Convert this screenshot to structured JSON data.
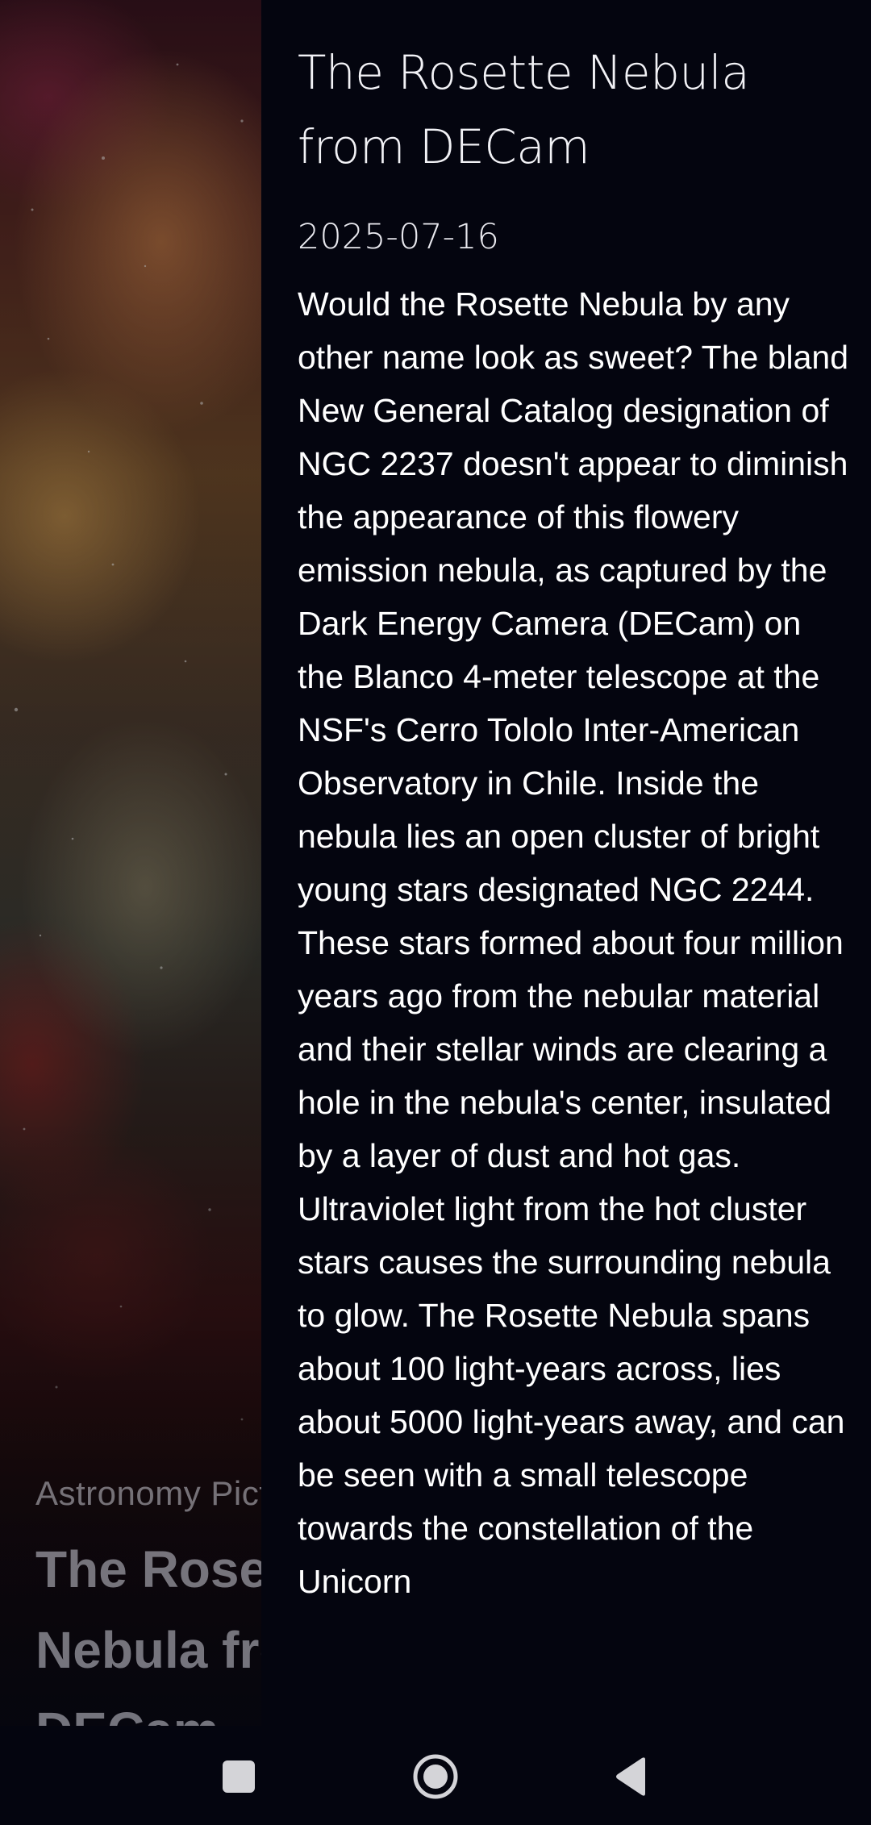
{
  "background_card": {
    "subtitle": "Astronomy Picture of the Day",
    "title": "The Rosette Nebula from DECam"
  },
  "detail": {
    "title": "The Rosette Nebula from DECam",
    "date": "2025-07-16",
    "explanation": "Would the Rosette Nebula by any other name look as sweet? The bland New General Catalog designation of NGC 2237 doesn't appear to diminish the appearance of this flowery emission nebula, as captured by the Dark Energy Camera (DECam) on the Blanco 4-meter telescope at the NSF's Cerro Tololo Inter-American Observatory in Chile. Inside the nebula lies an open cluster of bright young stars designated NGC 2244. These stars formed about four million years ago from the nebular material and their stellar winds are clearing a hole in the nebula's center, insulated by a layer of dust and hot gas. Ultraviolet light from the hot cluster stars causes the surrounding nebula to glow. The Rosette Nebula spans about 100 light-years across, lies about 5000 light-years away, and can be seen with a small telescope towards the constellation of the Unicorn"
  },
  "navbar": {
    "recents_icon": "square-recents-icon",
    "home_icon": "circle-home-icon",
    "back_icon": "triangle-back-icon"
  },
  "colors": {
    "panel_background": "#04050f",
    "text_primary": "#ffffff"
  }
}
